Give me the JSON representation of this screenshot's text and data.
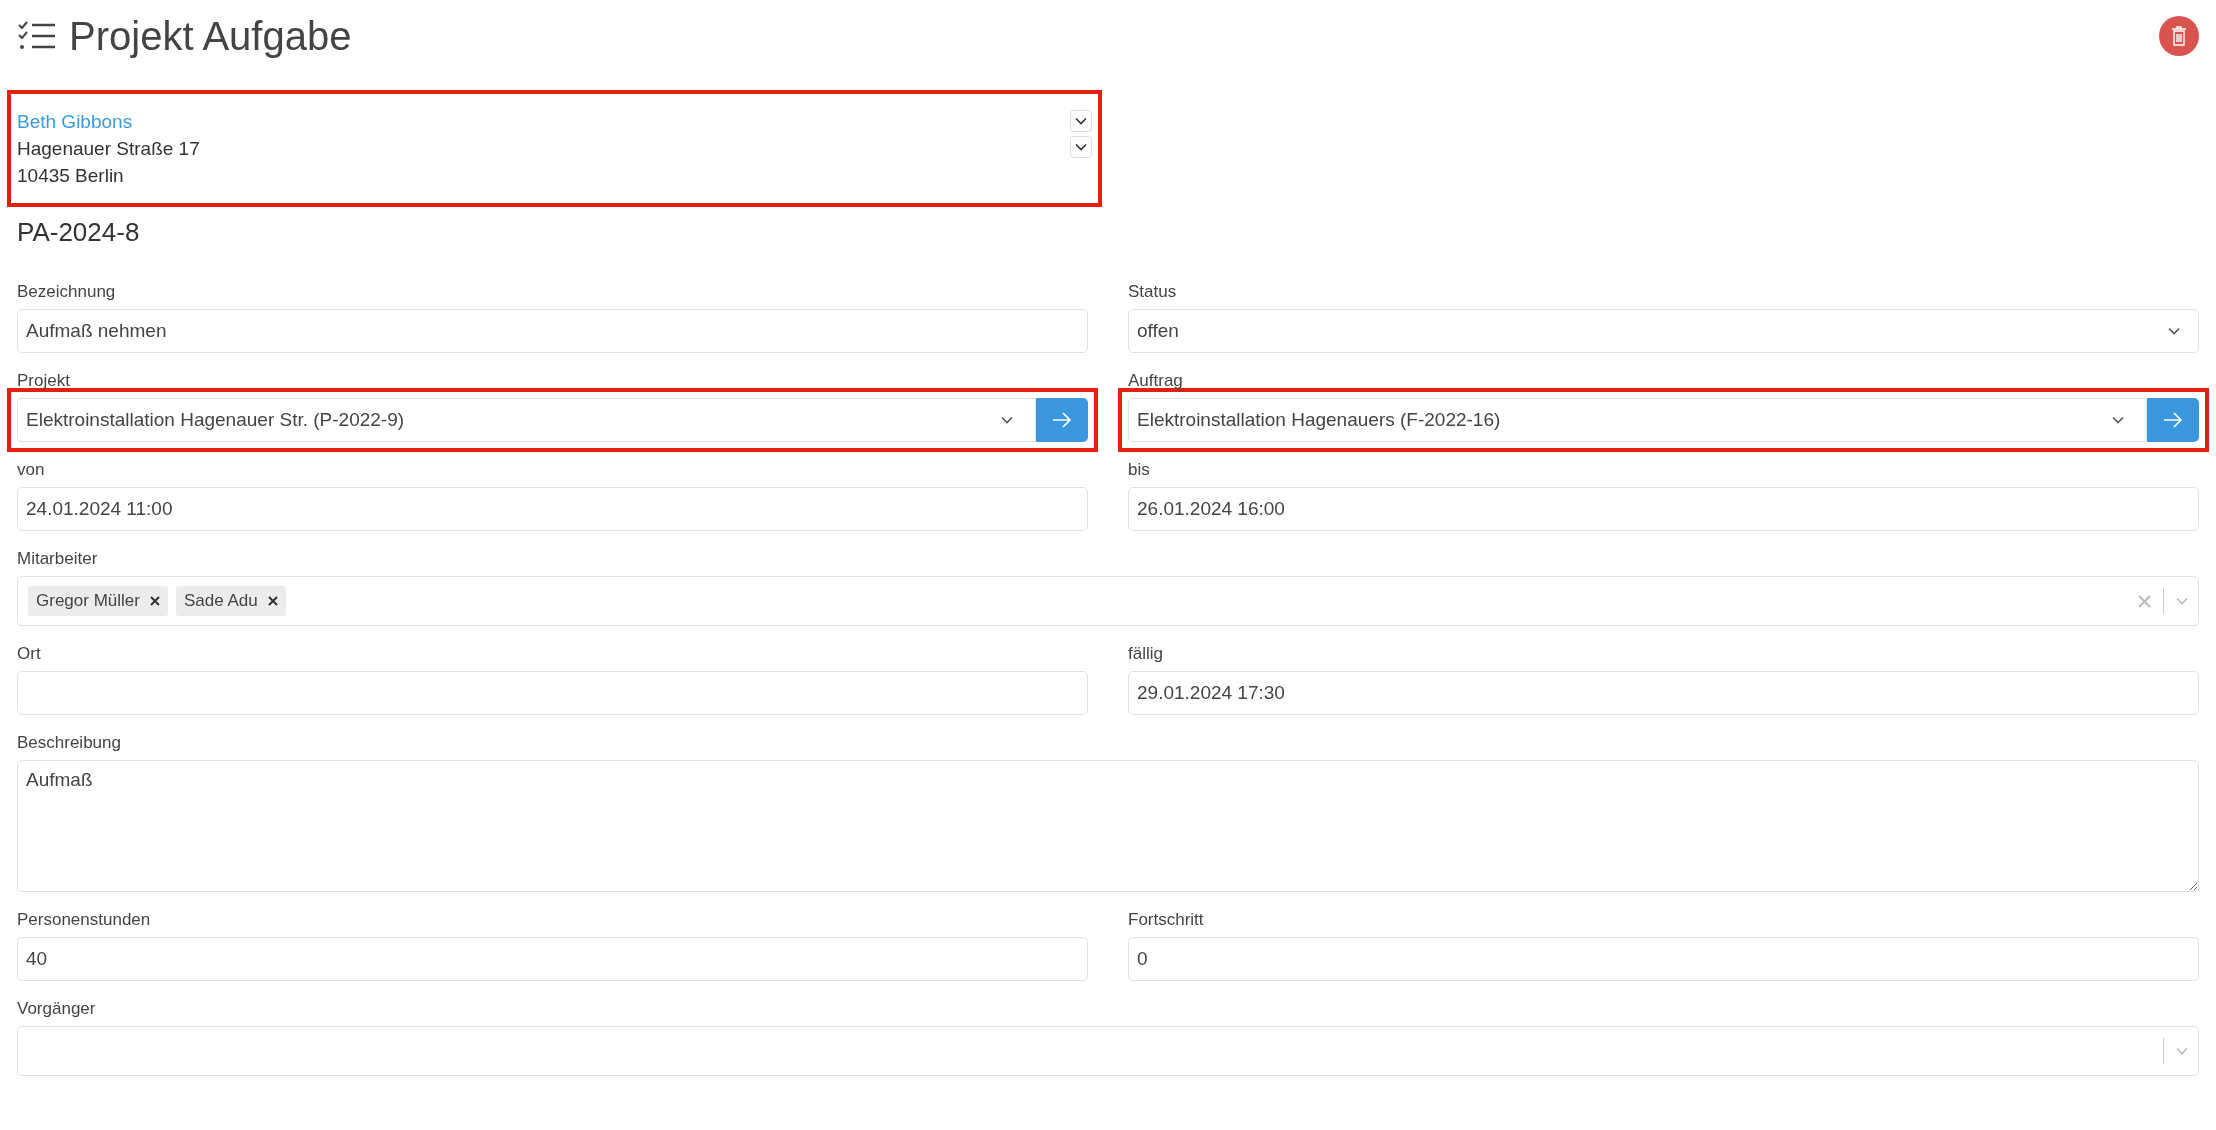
{
  "header": {
    "title": "Projekt Aufgabe"
  },
  "contact": {
    "highlighted": true,
    "name": "Beth Gibbons",
    "lines": [
      "Hagenauer Straße 17",
      "10435 Berlin"
    ]
  },
  "number": "PA-2024-8",
  "rows": [
    [
      {
        "label": "Bezeichnung",
        "kind": "text",
        "value": "Aufmaß nehmen",
        "highlighted": false
      },
      {
        "label": "Status",
        "kind": "select",
        "value": "offen",
        "highlighted": false
      }
    ],
    [
      {
        "label": "Projekt",
        "kind": "link-select",
        "value": "Elektroinstallation Hagenauer Str. (P-2022-9)",
        "highlighted": true
      },
      {
        "label": "Auftrag",
        "kind": "link-select",
        "value": "Elektroinstallation Hagenauers (F-2022-16)",
        "highlighted": true
      }
    ],
    [
      {
        "label": "von",
        "kind": "text",
        "value": "24.01.2024 11:00",
        "highlighted": false
      },
      {
        "label": "bis",
        "kind": "text",
        "value": "26.01.2024 16:00",
        "highlighted": false
      }
    ],
    [
      {
        "label": "Mitarbeiter",
        "kind": "tags",
        "tags": [
          "Gregor Müller",
          "Sade Adu"
        ],
        "highlighted": false
      }
    ],
    [
      {
        "label": "Ort",
        "kind": "text",
        "highlighted": false
      },
      {
        "label": "fällig",
        "kind": "text",
        "value": "29.01.2024 17:30",
        "highlighted": false
      }
    ],
    [
      {
        "label": "Beschreibung",
        "kind": "textarea",
        "value": "Aufmaß",
        "highlighted": false
      }
    ],
    [
      {
        "label": "Personenstunden",
        "kind": "text",
        "value": "40",
        "highlighted": false
      },
      {
        "label": "Fortschritt",
        "kind": "text",
        "value": "0",
        "highlighted": false
      }
    ],
    [
      {
        "label": "Vorgänger",
        "kind": "combo",
        "highlighted": false
      }
    ]
  ]
}
